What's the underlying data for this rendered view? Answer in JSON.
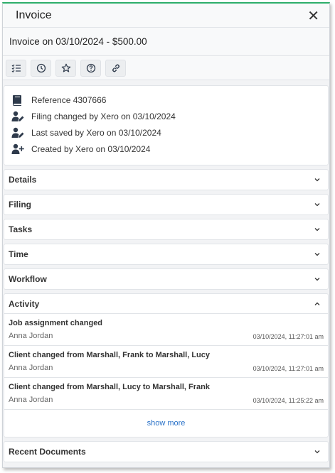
{
  "header": {
    "title": "Invoice",
    "close_label": "✕"
  },
  "subheader": {
    "title": "Invoice on 03/10/2024 - $500.00"
  },
  "toolbar": {
    "buttons": [
      {
        "icon": "checklist-icon"
      },
      {
        "icon": "clock-icon"
      },
      {
        "icon": "star-icon"
      },
      {
        "icon": "help-icon"
      },
      {
        "icon": "link-icon"
      }
    ]
  },
  "info": {
    "reference": "Reference 4307666",
    "filing_changed": "Filing changed by Xero on 03/10/2024",
    "last_saved": "Last saved by Xero on 03/10/2024",
    "created": "Created by Xero on 03/10/2024"
  },
  "sections": {
    "details": "Details",
    "filing": "Filing",
    "tasks": "Tasks",
    "time": "Time",
    "workflow": "Workflow",
    "activity": "Activity",
    "recent_documents": "Recent Documents"
  },
  "activity": {
    "items": [
      {
        "title": "Job assignment changed",
        "user": "Anna Jordan",
        "time": "03/10/2024, 11:27:01 am"
      },
      {
        "title": "Client changed from Marshall, Frank to Marshall, Lucy",
        "user": "Anna Jordan",
        "time": "03/10/2024, 11:27:01 am"
      },
      {
        "title": "Client changed from Marshall, Lucy to Marshall, Frank",
        "user": "Anna Jordan",
        "time": "03/10/2024, 11:25:22 am"
      }
    ],
    "show_more": "show more"
  },
  "colors": {
    "accent": "#2dae6a",
    "link": "#2a72c8",
    "icon": "#2f3b4c"
  }
}
